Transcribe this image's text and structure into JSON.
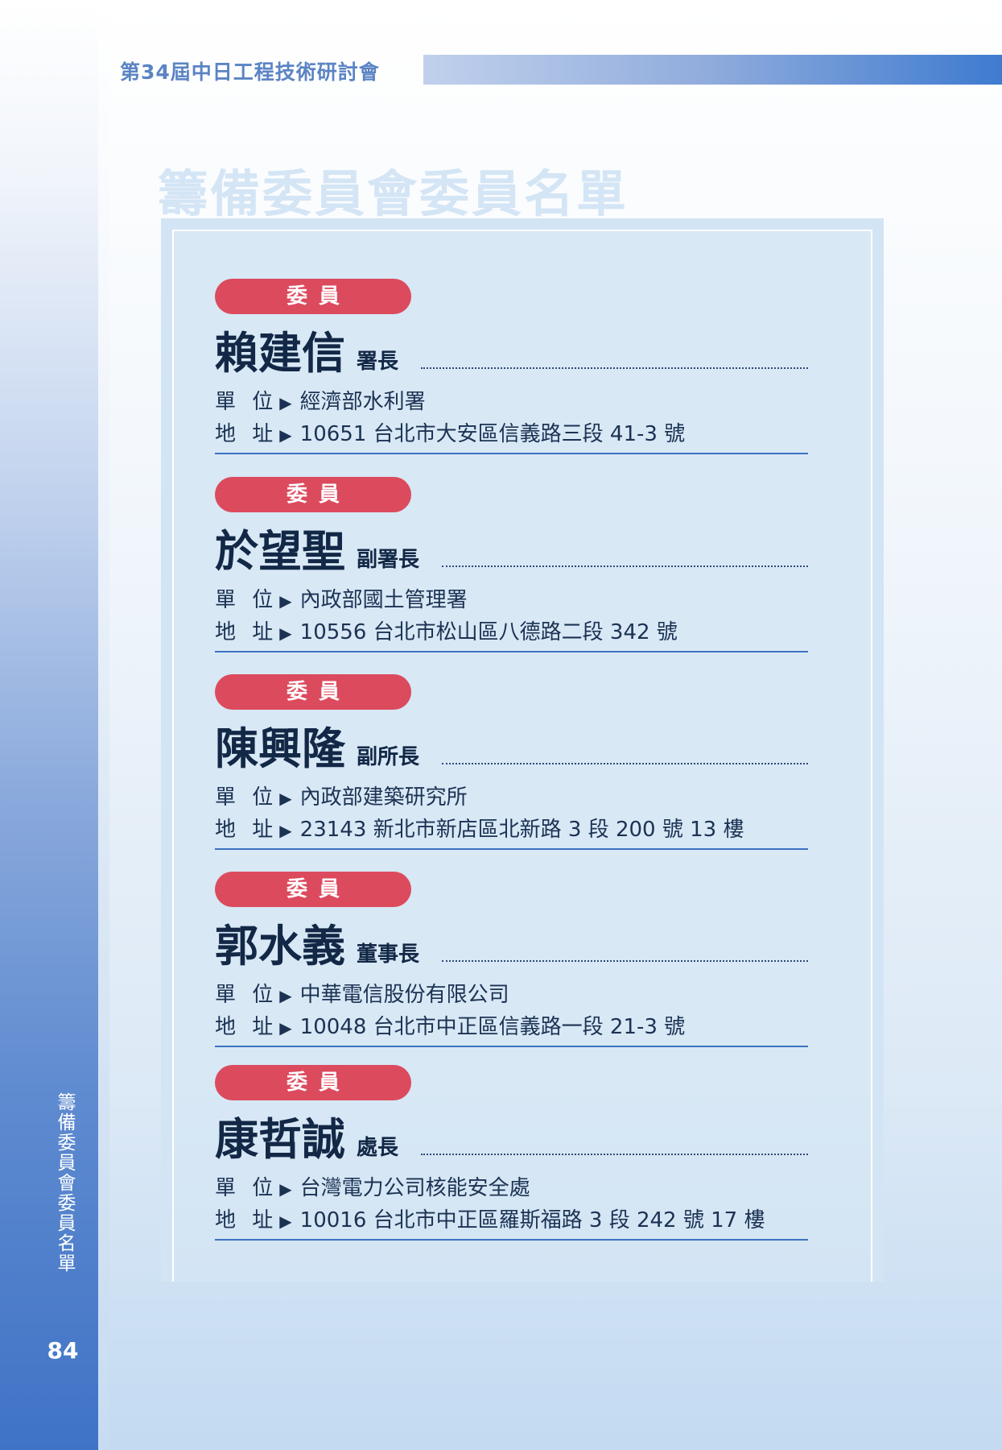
{
  "header": {
    "title": "第34屆中日工程技術研討會"
  },
  "section_title": "籌備委員會委員名單",
  "sidebar": {
    "label": "籌備委員會委員名單",
    "page_number": "84"
  },
  "labels": {
    "unit": "單 位",
    "address": "地 址",
    "arrow": "▶"
  },
  "members": [
    {
      "role": "委員",
      "name": "賴建信",
      "title": "署長",
      "unit": "經濟部水利署",
      "address": "10651 台北市大安區信義路三段 41-3 號"
    },
    {
      "role": "委員",
      "name": "於望聖",
      "title": "副署長",
      "unit": "內政部國土管理署",
      "address": "10556 台北市松山區八德路二段 342 號"
    },
    {
      "role": "委員",
      "name": "陳興隆",
      "title": "副所長",
      "unit": "內政部建築研究所",
      "address": "23143 新北市新店區北新路 3 段 200 號 13 樓"
    },
    {
      "role": "委員",
      "name": "郭水義",
      "title": "董事長",
      "unit": "中華電信股份有限公司",
      "address": "10048 台北市中正區信義路一段 21-3 號"
    },
    {
      "role": "委員",
      "name": "康哲誠",
      "title": "處長",
      "unit": "台灣電力公司核能安全處",
      "address": "10016 台北市中正區羅斯福路 3 段 242 號 17 樓"
    }
  ]
}
